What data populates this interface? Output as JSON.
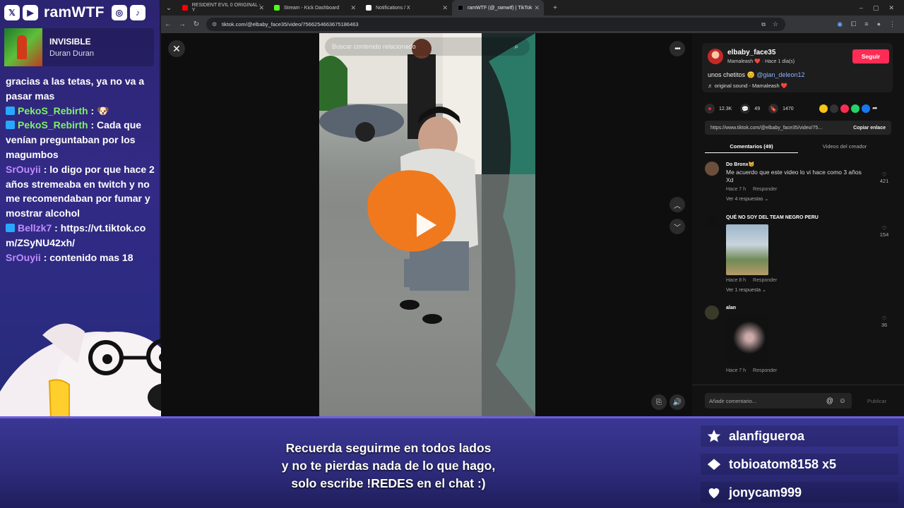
{
  "overlay": {
    "brand_name": "ramWTF",
    "now_playing": {
      "title": "INVISIBLE",
      "artist": "Duran Duran"
    },
    "chat": [
      {
        "user": "",
        "text": "gracias a las tetas, ya no va a pasar mas"
      },
      {
        "user": "PekoS_Rebirth",
        "text": ""
      },
      {
        "user": "PekoS_Rebirth",
        "text": ": Cada que venían preguntaban por los magumbos"
      },
      {
        "user": "SrOuyii",
        "text": ": lo digo por que hace 2 años stremeaba en twitch y no me recomendaban por fumar y mostrar alcohol"
      },
      {
        "user": "Bellzk7",
        "text": ": https://vt.tiktok.com/ZSyNU42xh/"
      },
      {
        "user": "SrOuyii",
        "text": ": contenido mas 18"
      }
    ],
    "message_lines": [
      "Recuerda seguirme en todos lados",
      "y no te pierdas nada de lo que hago,",
      "solo escribe !REDES en el chat :)"
    ],
    "events": [
      {
        "icon": "star-icon",
        "text": "alanfigueroa"
      },
      {
        "icon": "diamond-icon",
        "text": "tobioatom8158  x5"
      },
      {
        "icon": "heart-icon",
        "text": "jonycam999"
      }
    ]
  },
  "browser": {
    "tabs": [
      {
        "label": "RESIDENT EVIL 0 ORIGINAL - Y",
        "color": "#ff0000"
      },
      {
        "label": "Stream - Kick Dashboard",
        "color": "#53fc18"
      },
      {
        "label": "Notifications / X",
        "color": "#ffffff"
      },
      {
        "label": "ramWTF (@_ramwtf) | TikTok",
        "color": "#000000"
      }
    ],
    "url": "tiktok.com/@elbaby_face35/video/7566254663675186463"
  },
  "video": {
    "search_placeholder": "Buscar contenido relacionado"
  },
  "post": {
    "author": "elbaby_face35",
    "author_sub": "Mamaleash ❤️ · Hace 1 día(s)",
    "follow_label": "Seguir",
    "caption_text": "unos chetitos 😊",
    "caption_mention": "@gian_deleon12",
    "music": "♬ original sound - Mamaleash ❤️",
    "likes": "12.3K",
    "comments_count": "49",
    "saves": "1470",
    "link": "https://www.tiktok.com/@elbaby_face35/video/75...",
    "copy_label": "Copiar enlace",
    "tab_comments": "Comentarios (49)",
    "tab_videos": "Videos del creador",
    "comment_placeholder": "Añadir comentario...",
    "publish_label": "Publicar"
  },
  "comments": [
    {
      "user": "Do Bronx😼",
      "text": "Me acuerdo que este video lo vi hace como 3 años Xd",
      "time": "Hace 7 h",
      "reply": "Responder",
      "replies": "Ver 4 respuestas ⌄",
      "likes": "421"
    },
    {
      "user": "QUÉ NO SOY DEL TEAM NEGRO PERU",
      "text": "",
      "time": "Hace 8 h",
      "reply": "Responder",
      "replies": "Ver 1 respuesta ⌄",
      "likes": "154"
    },
    {
      "user": "alan",
      "text": "",
      "time": "Hace 7 h",
      "reply": "Responder",
      "replies": "",
      "likes": "36"
    }
  ]
}
